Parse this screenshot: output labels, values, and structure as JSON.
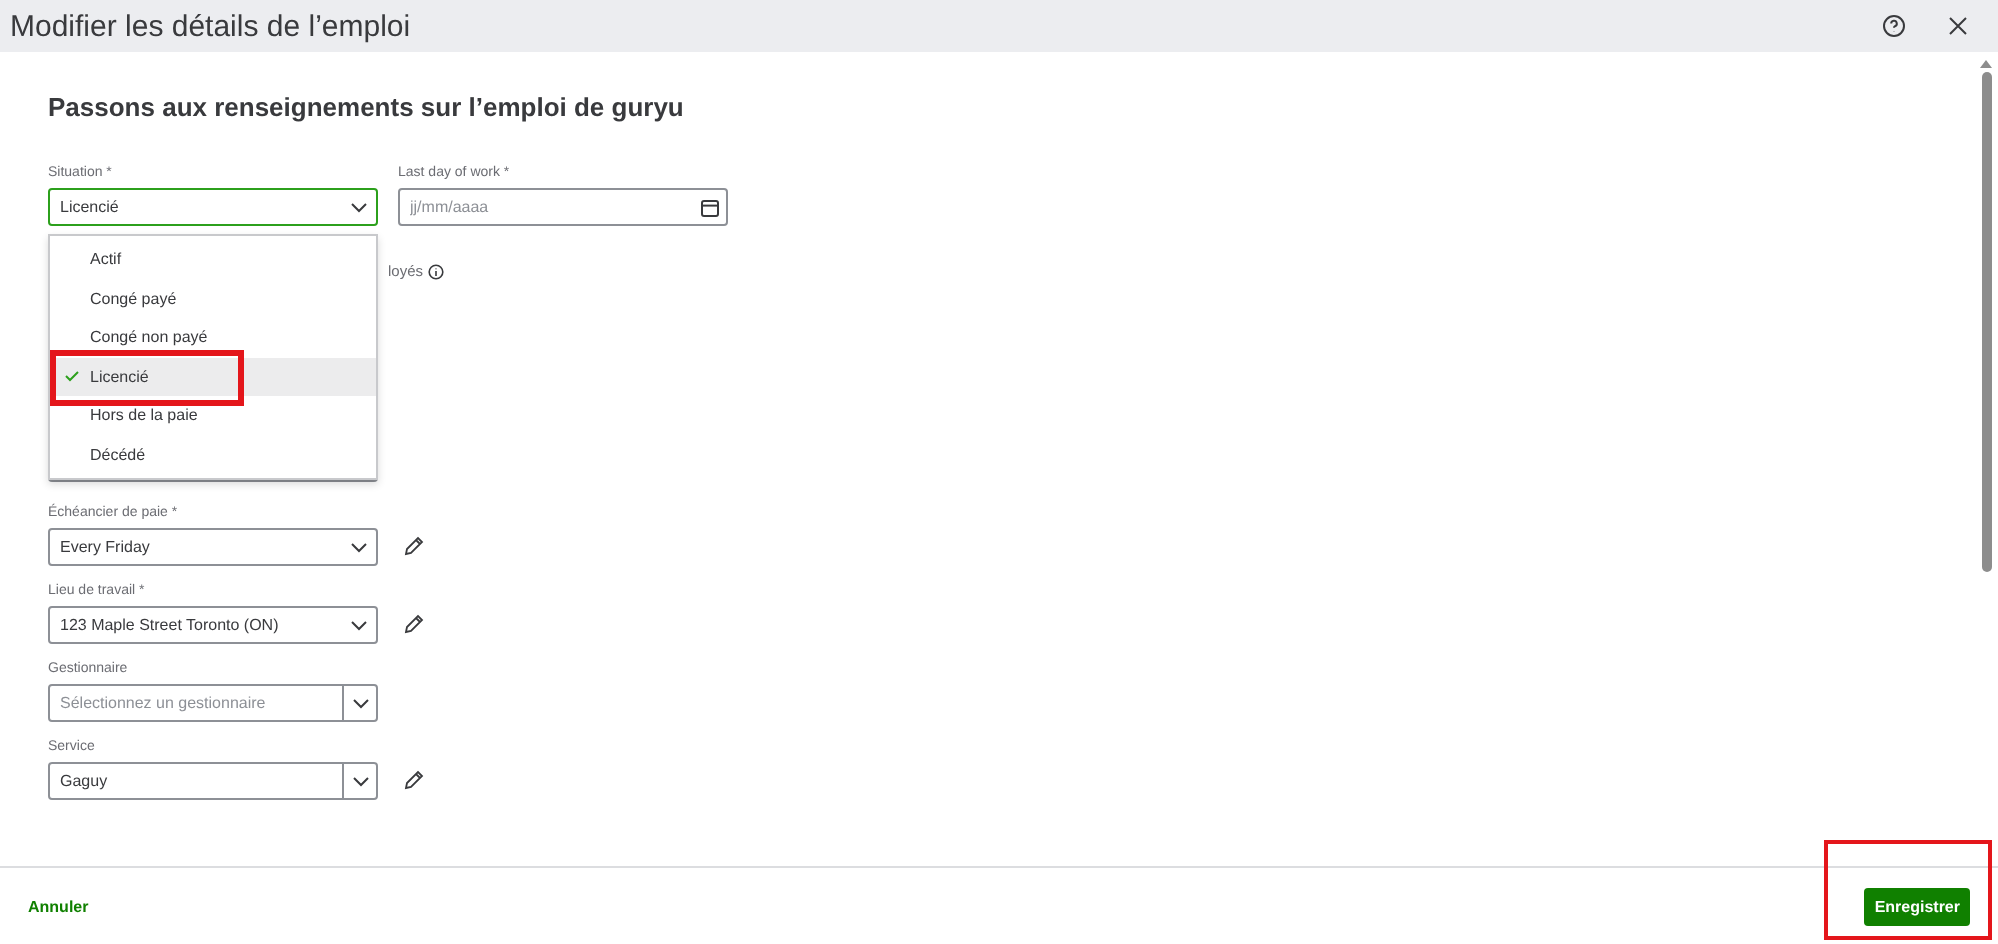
{
  "window": {
    "title": "Modifier les détails de l’emploi"
  },
  "heading": "Passons aux renseignements sur l’emploi de guryu",
  "situation": {
    "label": "Situation *",
    "value": "Licencié",
    "expanded": true
  },
  "last_day": {
    "label": "Last day of work *",
    "placeholder": "jj/mm/aaaa"
  },
  "dropdown": [
    {
      "label": "Actif",
      "selected": false
    },
    {
      "label": "Congé payé",
      "selected": false
    },
    {
      "label": "Congé non payé",
      "selected": false
    },
    {
      "label": "Licencié",
      "selected": true
    },
    {
      "label": "Hors de la paie",
      "selected": false
    },
    {
      "label": "Décédé",
      "selected": false
    }
  ],
  "hidden_label": "loyés",
  "fields": [
    {
      "label": "Échéancier de paie *",
      "kind": "select",
      "value": "Every Friday",
      "editable": true
    },
    {
      "label": "Lieu de travail *",
      "kind": "select",
      "value": "123 Maple Street Toronto (ON)",
      "editable": true
    },
    {
      "label": "Gestionnaire",
      "kind": "combo",
      "placeholder": "Sélectionnez un gestionnaire",
      "editable": false
    },
    {
      "label": "Service",
      "kind": "combo",
      "value": "Gaguy",
      "editable": true
    }
  ],
  "footer": {
    "cancel": "Annuler",
    "save": "Enregistrer"
  }
}
